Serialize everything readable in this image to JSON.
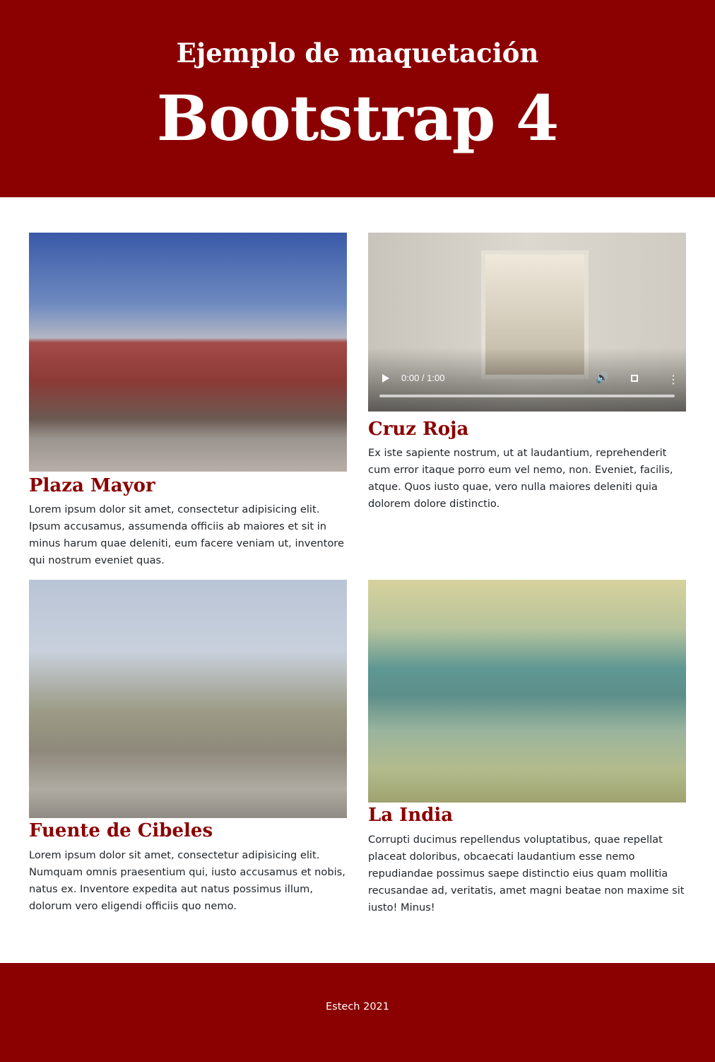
{
  "header": {
    "subtitle": "Ejemplo de maquetación",
    "title": "Bootstrap 4",
    "background_color": "#8b0000"
  },
  "cards": [
    {
      "title": "Plaza Mayor",
      "media": "image",
      "text": "Lorem ipsum dolor sit amet, consectetur adipisicing elit. Ipsum accusamus, assumenda officiis ab maiores et sit in minus harum quae deleniti, eum facere veniam ut, inventore qui nostrum eveniet quas."
    },
    {
      "title": "Cruz Roja",
      "media": "video",
      "video_time": "0:00 / 1:00",
      "text": "Ex iste sapiente nostrum, ut at laudantium, reprehenderit cum error itaque porro eum vel nemo, non. Eveniet, facilis, atque. Quos iusto quae, vero nulla maiores deleniti quia dolorem dolore distinctio."
    },
    {
      "title": "Fuente de Cibeles",
      "media": "image",
      "text": "Lorem ipsum dolor sit amet, consectetur adipisicing elit. Numquam omnis praesentium qui, iusto accusamus et nobis, natus ex. Inventore expedita aut natus possimus illum, dolorum vero eligendi officiis quo nemo."
    },
    {
      "title": "La India",
      "media": "image",
      "text": "Corrupti ducimus repellendus voluptatibus, quae repellat placeat doloribus, obcaecati laudantium esse nemo repudiandae possimus saepe distinctio eius quam mollitia recusandae ad, veritatis, amet magni beatae non maxime sit iusto! Minus!"
    }
  ],
  "footer": {
    "text": "Estech 2021"
  },
  "colors": {
    "accent": "#8b0000",
    "text": "#212529"
  }
}
